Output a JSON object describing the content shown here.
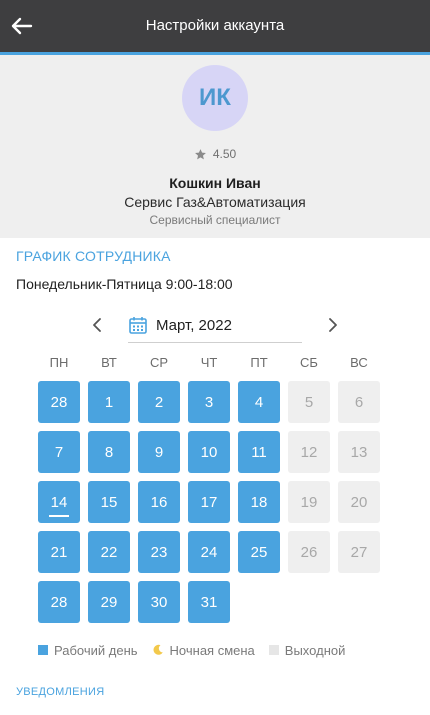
{
  "header": {
    "title": "Настройки аккаунта",
    "back_icon": "arrow-left-icon"
  },
  "profile": {
    "initials": "ИК",
    "rating": "4.50",
    "name": "Кошкин Иван",
    "company": "Сервис Газ&Автоматизация",
    "role": "Сервисный специалист"
  },
  "schedule_section": {
    "title": "ГРАФИК СОТРУДНИКА",
    "hours": "Понедельник-Пятница 9:00-18:00"
  },
  "calendar": {
    "month": "Март, 2022",
    "weekdays": [
      "ПН",
      "ВТ",
      "СР",
      "ЧТ",
      "ПТ",
      "СБ",
      "ВС"
    ],
    "weeks": [
      [
        {
          "d": "28",
          "t": "work"
        },
        {
          "d": "1",
          "t": "work"
        },
        {
          "d": "2",
          "t": "work"
        },
        {
          "d": "3",
          "t": "work"
        },
        {
          "d": "4",
          "t": "work"
        },
        {
          "d": "5",
          "t": "off"
        },
        {
          "d": "6",
          "t": "off"
        }
      ],
      [
        {
          "d": "7",
          "t": "work"
        },
        {
          "d": "8",
          "t": "work"
        },
        {
          "d": "9",
          "t": "work"
        },
        {
          "d": "10",
          "t": "work"
        },
        {
          "d": "11",
          "t": "work"
        },
        {
          "d": "12",
          "t": "off"
        },
        {
          "d": "13",
          "t": "off"
        }
      ],
      [
        {
          "d": "14",
          "t": "work",
          "today": true
        },
        {
          "d": "15",
          "t": "work"
        },
        {
          "d": "16",
          "t": "work"
        },
        {
          "d": "17",
          "t": "work"
        },
        {
          "d": "18",
          "t": "work"
        },
        {
          "d": "19",
          "t": "off"
        },
        {
          "d": "20",
          "t": "off"
        }
      ],
      [
        {
          "d": "21",
          "t": "work"
        },
        {
          "d": "22",
          "t": "work"
        },
        {
          "d": "23",
          "t": "work"
        },
        {
          "d": "24",
          "t": "work"
        },
        {
          "d": "25",
          "t": "work"
        },
        {
          "d": "26",
          "t": "off"
        },
        {
          "d": "27",
          "t": "off"
        }
      ],
      [
        {
          "d": "28",
          "t": "work"
        },
        {
          "d": "29",
          "t": "work"
        },
        {
          "d": "30",
          "t": "work"
        },
        {
          "d": "31",
          "t": "work"
        }
      ]
    ]
  },
  "legend": {
    "work_day": "Рабочий день",
    "night_shift": "Ночная смена",
    "day_off": "Выходной"
  },
  "notifications": {
    "title": "УВЕДОМЛЕНИЯ"
  },
  "colors": {
    "accent": "#4aa3df",
    "header_bg": "#3e3e40",
    "off_bg": "#efefef",
    "night": "#f3c94b"
  }
}
